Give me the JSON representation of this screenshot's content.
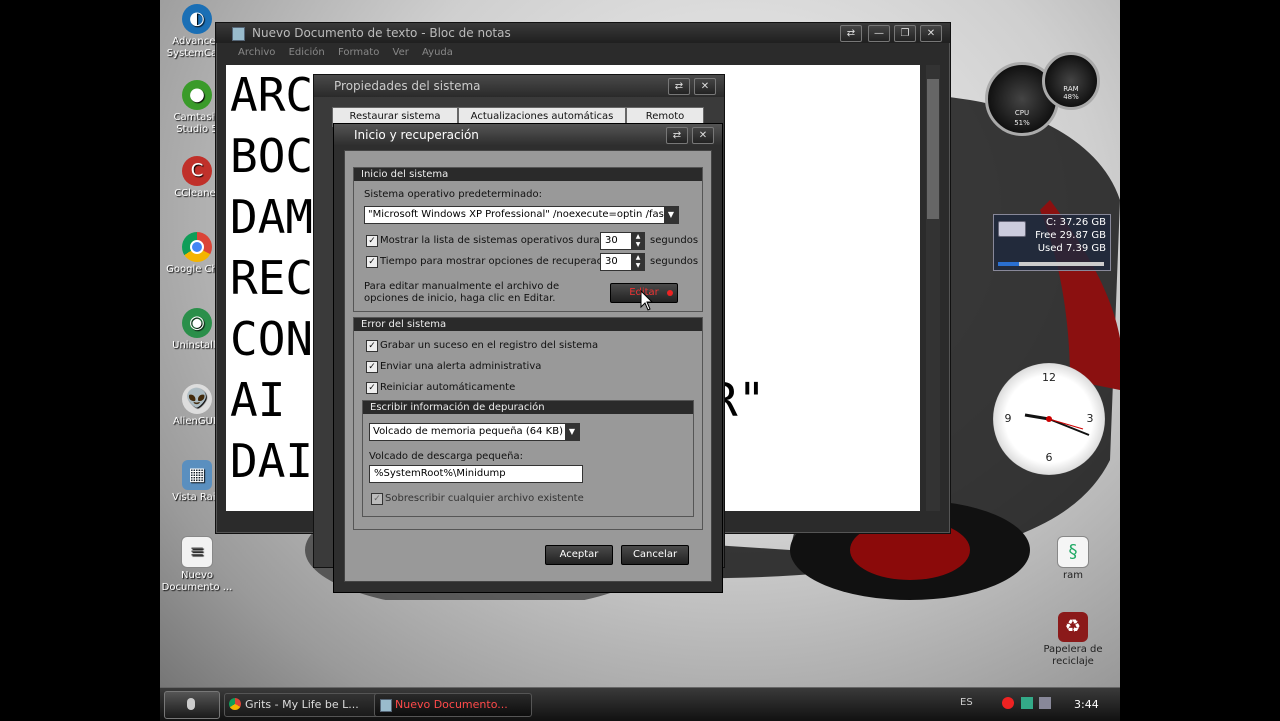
{
  "desktop": {
    "icons": [
      {
        "label": "Advanced SystemCare",
        "icon": "advanced-systemcare-icon"
      },
      {
        "label": "Camtasia Studio 5",
        "icon": "camtasia-icon"
      },
      {
        "label": "CCleaner",
        "icon": "ccleaner-icon"
      },
      {
        "label": "Google Chro",
        "icon": "chrome-icon"
      },
      {
        "label": "Uninstalle",
        "icon": "uninstaller-icon"
      },
      {
        "label": "AlienGUIs",
        "icon": "alien-icon"
      },
      {
        "label": "Vista Rain",
        "icon": "vista-rain-icon"
      },
      {
        "label": "Nuevo Documento ...",
        "icon": "text-document-icon"
      }
    ],
    "right_icons": [
      {
        "label": "ram",
        "icon": "script-file-icon"
      },
      {
        "label": "Papelera de reciclaje",
        "icon": "recycle-bin-icon"
      }
    ]
  },
  "notepad": {
    "title": "Nuevo Documento de texto - Bloc de notas",
    "menu": [
      "Archivo",
      "Edición",
      "Formato",
      "Ver",
      "Ayuda"
    ],
    "lines": [
      "ARC",
      "BOC",
      "DAM",
      "REC",
      "CON",
      "AI",
      "DAI"
    ],
    "partial": "R\""
  },
  "system_properties": {
    "title": "Propiedades del sistema",
    "tabs": [
      "Restaurar sistema",
      "Actualizaciones automáticas",
      "Remoto"
    ]
  },
  "startup_dialog": {
    "title": "Inicio y recuperación",
    "startup_group": "Inicio del sistema",
    "default_os_label": "Sistema operativo predeterminado:",
    "default_os_value": "\"Microsoft Windows XP Professional\" /noexecute=optin /fastdete",
    "show_list_label": "Mostrar la lista de sistemas operativos durante:",
    "show_list_value": "30",
    "recovery_time_label": "Tiempo para mostrar opciones de recuperación:",
    "recovery_time_value": "30",
    "seconds": "segundos",
    "edit_hint": "Para editar manualmente el archivo de opciones de inicio, haga clic en Editar.",
    "edit_button": "Editar",
    "error_group": "Error del sistema",
    "log_event": "Grabar un suceso en el registro del sistema",
    "send_alert": "Enviar una alerta administrativa",
    "auto_restart": "Reiniciar automáticamente",
    "debug_group": "Escribir información de depuración",
    "dump_type": "Volcado de memoria pequeña (64 KB)",
    "dump_dir_label": "Volcado de descarga pequeña:",
    "dump_dir_value": "%SystemRoot%\\Minidump",
    "overwrite": "Sobrescribir cualquier archivo existente",
    "ok": "Aceptar",
    "cancel": "Cancelar"
  },
  "gadgets": {
    "cpu_label": "CPU",
    "cpu_value": "51%",
    "ram_label": "RAM",
    "ram_value": "48%",
    "drive_c": "C: 37.26 GB",
    "drive_free": "Free 29.87 GB",
    "drive_used": "Used 7.39 GB",
    "drive_used_fraction": 0.2
  },
  "taskbar": {
    "items": [
      "Grits - My Life be L...",
      "Nuevo Documento..."
    ],
    "lang": "ES",
    "time": "3:44"
  },
  "colors": {
    "accent_red": "#ff4a4a"
  }
}
